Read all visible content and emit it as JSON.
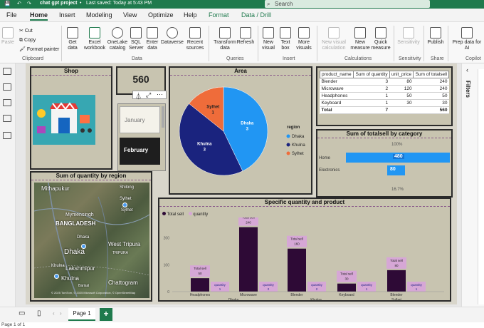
{
  "titlebar": {
    "file_title": "chat gpt project",
    "saved_status": "Last saved: Today at 5:43 PM",
    "search_placeholder": "Search"
  },
  "tabs": [
    {
      "label": "File"
    },
    {
      "label": "Home"
    },
    {
      "label": "Insert"
    },
    {
      "label": "Modeling"
    },
    {
      "label": "View"
    },
    {
      "label": "Optimize"
    },
    {
      "label": "Help"
    },
    {
      "label": "Format"
    },
    {
      "label": "Data / Drill"
    }
  ],
  "ribbon": {
    "clipboard": {
      "paste": "Paste",
      "cut": "Cut",
      "copy": "Copy",
      "format_painter": "Format painter",
      "group": "Clipboard"
    },
    "data": {
      "get_data": "Get data",
      "excel": "Excel workbook",
      "onelake": "OneLake catalog",
      "sql": "SQL Server",
      "enter_data": "Enter data",
      "dataverse": "Dataverse",
      "recent": "Recent sources",
      "group": "Data"
    },
    "queries": {
      "transform": "Transform data",
      "refresh": "Refresh",
      "group": "Queries"
    },
    "insert": {
      "new_visual": "New visual",
      "text_box": "Text box",
      "more_visuals": "More visuals",
      "group": "Insert"
    },
    "calculations": {
      "new_visual_calc": "New visual calculation",
      "new_measure": "New measure",
      "quick_measure": "Quick measure",
      "group": "Calculations"
    },
    "sensitivity": {
      "label": "Sensitivity",
      "group": "Sensitivity"
    },
    "share": {
      "publish": "Publish",
      "group": "Share"
    },
    "copilot": {
      "prep": "Prep data for AI",
      "group": "Copilot"
    }
  },
  "visuals": {
    "shop": {
      "title": "Shop"
    },
    "card": {
      "value": "560"
    },
    "slicer": {
      "item1": "January",
      "item2": "February"
    },
    "area": {
      "title": "Area",
      "legend_title": "region",
      "legend": [
        "Dhaka",
        "Khulna",
        "Sylhet"
      ],
      "slices": [
        {
          "label": "Dhaka",
          "value": "3"
        },
        {
          "label": "Khulna",
          "value": "3"
        },
        {
          "label": "Sylhet",
          "value": "1"
        }
      ]
    },
    "table": {
      "headers": [
        "product_name",
        "Sum of quantity",
        "unit_price",
        "Sum of totalsell"
      ],
      "rows": [
        [
          "Blender",
          "3",
          "80",
          "240"
        ],
        [
          "Microwave",
          "2",
          "120",
          "240"
        ],
        [
          "Headphones",
          "1",
          "50",
          "50"
        ],
        [
          "Keyboard",
          "1",
          "30",
          "30"
        ]
      ],
      "total": [
        "Total",
        "7",
        "",
        "560"
      ]
    },
    "category": {
      "title": "Sum of totalsell by category",
      "top_pct": "100%",
      "bottom_pct": "16.7%",
      "bars": [
        {
          "label": "Home",
          "value": "480"
        },
        {
          "label": "Electronics",
          "value": "80"
        }
      ]
    },
    "map": {
      "title": "Sum of quantity by region",
      "places": [
        "Mithapukur",
        "Shilong",
        "Sylhet",
        "BANGLADESH",
        "Mymensingh",
        "Sylhet",
        "Dhaka",
        "Dhaka",
        "West Tripura",
        "TRIPURA",
        "Khulna",
        "Lakshmipur",
        "Khulna",
        "Chattogram",
        "Barisal"
      ],
      "credit": "© 2025 TomTom, © 2025 Microsoft Corporation, © OpenStreetMap"
    },
    "specific": {
      "title": "Specific quantity and product",
      "legend": [
        "Total sell",
        "quantity"
      ],
      "yticks": [
        "200",
        "100",
        "0"
      ],
      "groups": [
        {
          "product": "Headphones",
          "region": "Dhaka",
          "total_label": "Total sell",
          "total": "50",
          "qty_label": "quantity",
          "qty": "1"
        },
        {
          "product": "Microwave",
          "region": "",
          "total_label": "Total sell",
          "total": "240",
          "qty_label": "quantity",
          "qty": "2"
        },
        {
          "product": "Blender",
          "region": "Khulna",
          "total_label": "Total sell",
          "total": "160",
          "qty_label": "quantity",
          "qty": "2"
        },
        {
          "product": "Keyboard",
          "region": "",
          "total_label": "Total sell",
          "total": "30",
          "qty_label": "quantity",
          "qty": "1"
        },
        {
          "product": "Blender",
          "region": "Sylhet",
          "total_label": "Total sell",
          "total": "80",
          "qty_label": "quantity",
          "qty": "1"
        }
      ]
    }
  },
  "rightpane": {
    "filters": "Filters"
  },
  "pages": {
    "page1": "Page 1",
    "add": "+"
  },
  "status": {
    "text": "Page 1 of 1"
  },
  "colors": {
    "accent": "#1f7a4d",
    "dhaka": "#2196f3",
    "khulna": "#1a237e",
    "sylhet": "#ef6c3a",
    "dark_bar": "#2e0a36",
    "pink": "#d6a7d6"
  }
}
